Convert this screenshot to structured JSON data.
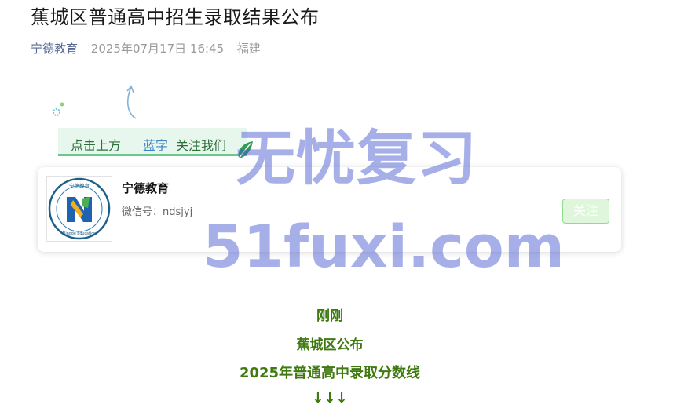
{
  "article": {
    "title": "蕉城区普通高中招生录取结果公布",
    "author": "宁德教育",
    "date": "2025年07月17日 16:45",
    "location": "福建"
  },
  "follow_banner": {
    "text_prefix": "点击上方",
    "text_blue": "蓝字",
    "text_suffix": "关注我们"
  },
  "account_card": {
    "name": "宁德教育",
    "wechat_id": "微信号：ndsjyj",
    "follow_label": "关注",
    "logo_text": "宁德教育",
    "logo_subtext": "Ningde Education"
  },
  "watermark": {
    "line1": "无忧复习",
    "line2": "51fuxi.com"
  },
  "body_lines": {
    "l1": "刚刚",
    "l2": "蕉城区公布",
    "l3": "2025年普通高中录取分数线",
    "l4": "↓↓↓"
  },
  "colors": {
    "author_link": "#576b95",
    "body_green": "#3f7a10",
    "banner_bg": "#e8f7ee",
    "watermark": "#4858d2"
  },
  "icons": [
    "sparkle-icon",
    "curved-arrow-icon",
    "leaf-icon",
    "ningde-education-logo"
  ]
}
